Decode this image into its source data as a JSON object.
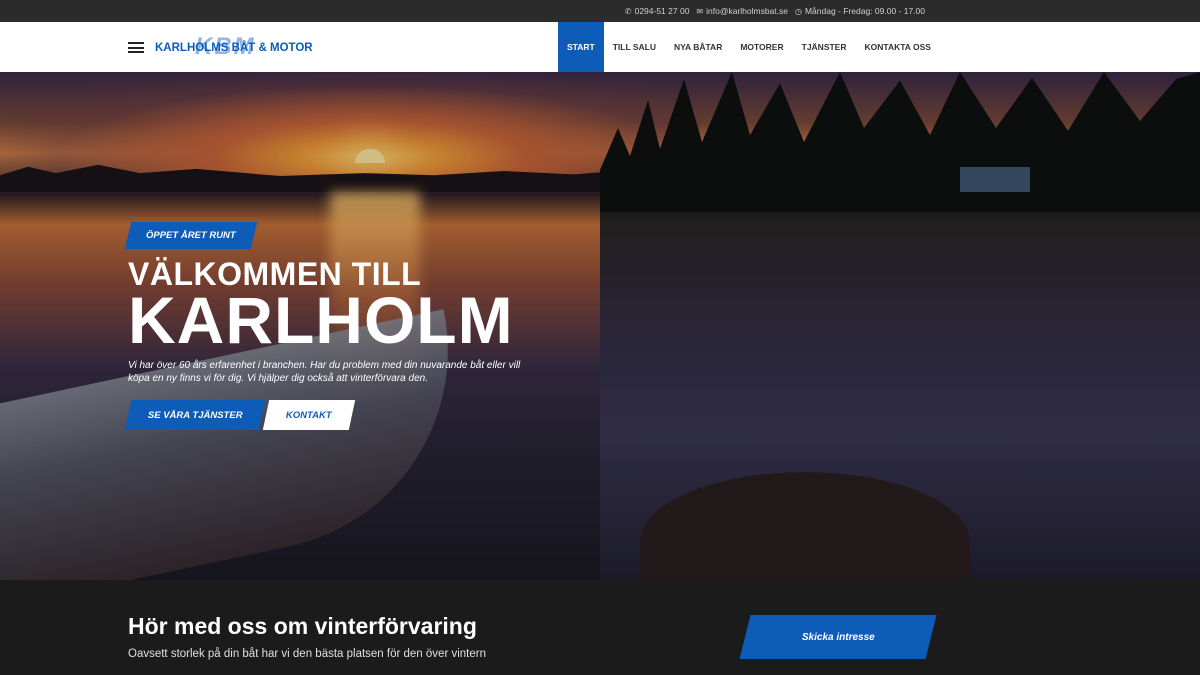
{
  "topbar": {
    "phone": "0294-51 27 00",
    "email": "info@karlholmsbat.se",
    "hours": "Måndag - Fredag: 09.00 - 17.00",
    "icons": {
      "phone": "phone-icon",
      "email": "envelope-icon",
      "hours": "clock-icon"
    }
  },
  "header": {
    "logo_mark": "KBM",
    "logo_text": "KARLHOLMS BÅT & MOTOR",
    "nav": [
      "START",
      "TILL SALU",
      "NYA BÅTAR",
      "MOTORER",
      "TJÄNSTER",
      "KONTAKTA OSS"
    ],
    "active_nav": "START"
  },
  "hero": {
    "badge": "ÖPPET ÅRET RUNT",
    "title_line1": "VÄLKOMMEN TILL",
    "title_line2": "KARLHOLM",
    "text": "Vi har över 60 års erfarenhet i branchen. Har du problem med din nuvarande båt eller vill köpa en ny finns vi för dig. Vi hjälper dig också att vinterförvara den.",
    "primary_button": "SE VÅRA TJÄNSTER",
    "secondary_button": "KONTAKT"
  },
  "cta": {
    "title": "Hör med oss om vinterförvaring",
    "subtitle": "Oavsett storlek på din båt har vi den bästa platsen för den över vintern",
    "button": "Skicka intresse"
  },
  "colors": {
    "accent": "#0c5cb8",
    "topbar": "#2b2b2b",
    "band": "#1b1b1b"
  }
}
